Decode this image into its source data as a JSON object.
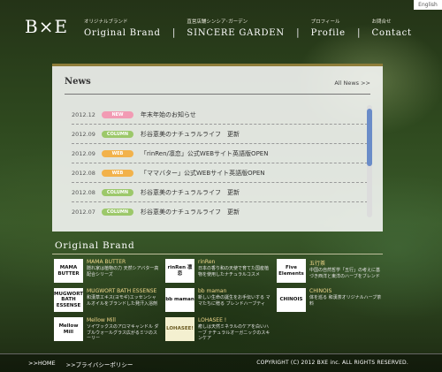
{
  "lang_button": "English",
  "logo": "B×E",
  "nav": [
    {
      "sub": "オリジナルブランド",
      "label": "Original Brand"
    },
    {
      "sub": "直営店舗シンシア･ガーデン",
      "label": "SINCERE GARDEN"
    },
    {
      "sub": "プロフィール",
      "label": "Profile"
    },
    {
      "sub": "お問合せ",
      "label": "Contact"
    }
  ],
  "news": {
    "title": "News",
    "all_link": "All News >>",
    "items": [
      {
        "date": "2012.12",
        "tag": "NEW",
        "tag_color": "#f29bb4",
        "text": "年末年始のお知らせ"
      },
      {
        "date": "2012.09",
        "tag": "COLUMN",
        "tag_color": "#9cc86a",
        "text": "杉谷恵美のナチュラルライフ　更新"
      },
      {
        "date": "2012.09",
        "tag": "WEB",
        "tag_color": "#f2b24b",
        "text": "「rinRen/凛恋」公式WEBサイト英語版OPEN"
      },
      {
        "date": "2012.08",
        "tag": "WEB",
        "tag_color": "#f2b24b",
        "text": "「ママバター」公式WEBサイト英語版OPEN"
      },
      {
        "date": "2012.08",
        "tag": "COLUMN",
        "tag_color": "#9cc86a",
        "text": "杉谷恵美のナチュラルライフ　更新"
      },
      {
        "date": "2012.07",
        "tag": "COLUMN",
        "tag_color": "#9cc86a",
        "text": "杉谷恵美のナチュラルライフ　更新"
      }
    ]
  },
  "brands": {
    "heading": "Original Brand",
    "items": [
      {
        "logo": "MAMA BUTTER",
        "name": "MAMA BUTTER",
        "desc": "隠れ家は植物の力 天然シアバター高配合シリーズ"
      },
      {
        "logo": "rinRen 凛恋",
        "name": "rinRen",
        "desc": "日本の香り和の天使で育てた国産植物を使用したナチュラルコスメ"
      },
      {
        "logo": "Five Elements",
        "name": "五行茶",
        "desc": "中国の自然哲学「五行」の考えに基づき西洋と東洋のハーブをブレンド"
      },
      {
        "logo": "MUGWORT BATH ESSENSE",
        "name": "MUGWORT BATH ESSENSE",
        "desc": "和漢草エキス(ヨモギ)エッセンシャルオイルをブランドした発汗入浴剤"
      },
      {
        "logo": "bb maman",
        "name": "bb maman",
        "desc": "新しい生命の誕生をお手伝いする ママたちに贈る ブレンドハーブティ"
      },
      {
        "logo": "CHINOIS",
        "name": "CHINOIS",
        "desc": "体を巡る 和漢茶オリジナルハーブ茶料"
      },
      {
        "logo": "Mellow Mill",
        "name": "Mellow Mill",
        "desc": "ソイワックスのアロマキャンドル ダブルウォールグラス広がるミツのスーリー"
      },
      {
        "logo": "LOHASEE!",
        "name": "LOHASEE !",
        "desc": "癒しは天然ミネラルのケアを白いハーブ ナチュラルオーガニックのスキンケア"
      }
    ]
  },
  "footer": {
    "links": [
      ">>HOME",
      ">>プライバシーポリシー"
    ],
    "copyright": "COPYRIGHT (C) 2012 BXE inc. ALL RIGHTS RESERVED."
  }
}
